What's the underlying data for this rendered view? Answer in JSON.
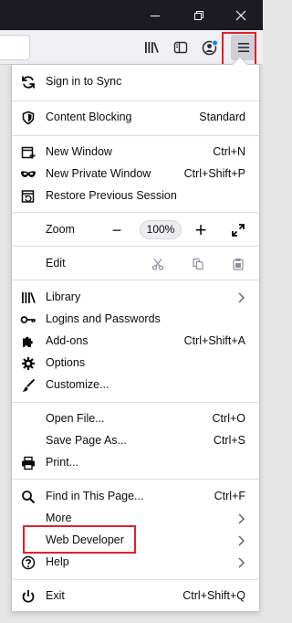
{
  "window": {
    "minimize_icon": "minimize-icon",
    "restore_icon": "restore-icon",
    "close_icon": "close-icon"
  },
  "toolbar": {
    "icons": [
      "library-icon",
      "sidebar-icon",
      "account-icon",
      "hamburger-menu-icon"
    ]
  },
  "colors": {
    "titlebar": "#1c1b22",
    "highlight": "#e0202d",
    "panel_bg": "#ffffff"
  },
  "menu": {
    "sync": {
      "label": "Sign in to Sync",
      "icon": "sync-icon"
    },
    "content_blocking": {
      "label": "Content Blocking",
      "value": "Standard",
      "icon": "shield-icon"
    },
    "new_window": {
      "label": "New Window",
      "shortcut": "Ctrl+N",
      "icon": "new-window-icon"
    },
    "new_private_window": {
      "label": "New Private Window",
      "shortcut": "Ctrl+Shift+P",
      "icon": "private-mask-icon"
    },
    "restore_session": {
      "label": "Restore Previous Session",
      "icon": "restore-session-icon"
    },
    "zoom": {
      "label": "Zoom",
      "minus": "−",
      "value": "100%",
      "plus": "+",
      "fullscreen_icon": "fullscreen-icon"
    },
    "edit": {
      "label": "Edit",
      "cut_icon": "cut-icon",
      "copy_icon": "copy-icon",
      "paste_icon": "paste-icon"
    },
    "library": {
      "label": "Library",
      "icon": "library-icon"
    },
    "logins": {
      "label": "Logins and Passwords",
      "icon": "key-icon"
    },
    "addons": {
      "label": "Add-ons",
      "shortcut": "Ctrl+Shift+A",
      "icon": "puzzle-icon"
    },
    "options": {
      "label": "Options",
      "icon": "gear-icon"
    },
    "customize": {
      "label": "Customize...",
      "icon": "paintbrush-icon"
    },
    "open_file": {
      "label": "Open File...",
      "shortcut": "Ctrl+O"
    },
    "save_page": {
      "label": "Save Page As...",
      "shortcut": "Ctrl+S"
    },
    "print": {
      "label": "Print...",
      "icon": "printer-icon"
    },
    "find": {
      "label": "Find in This Page...",
      "shortcut": "Ctrl+F",
      "icon": "search-icon"
    },
    "more": {
      "label": "More"
    },
    "web_developer": {
      "label": "Web Developer"
    },
    "help": {
      "label": "Help",
      "icon": "help-icon"
    },
    "exit": {
      "label": "Exit",
      "shortcut": "Ctrl+Shift+Q",
      "icon": "power-icon"
    }
  }
}
